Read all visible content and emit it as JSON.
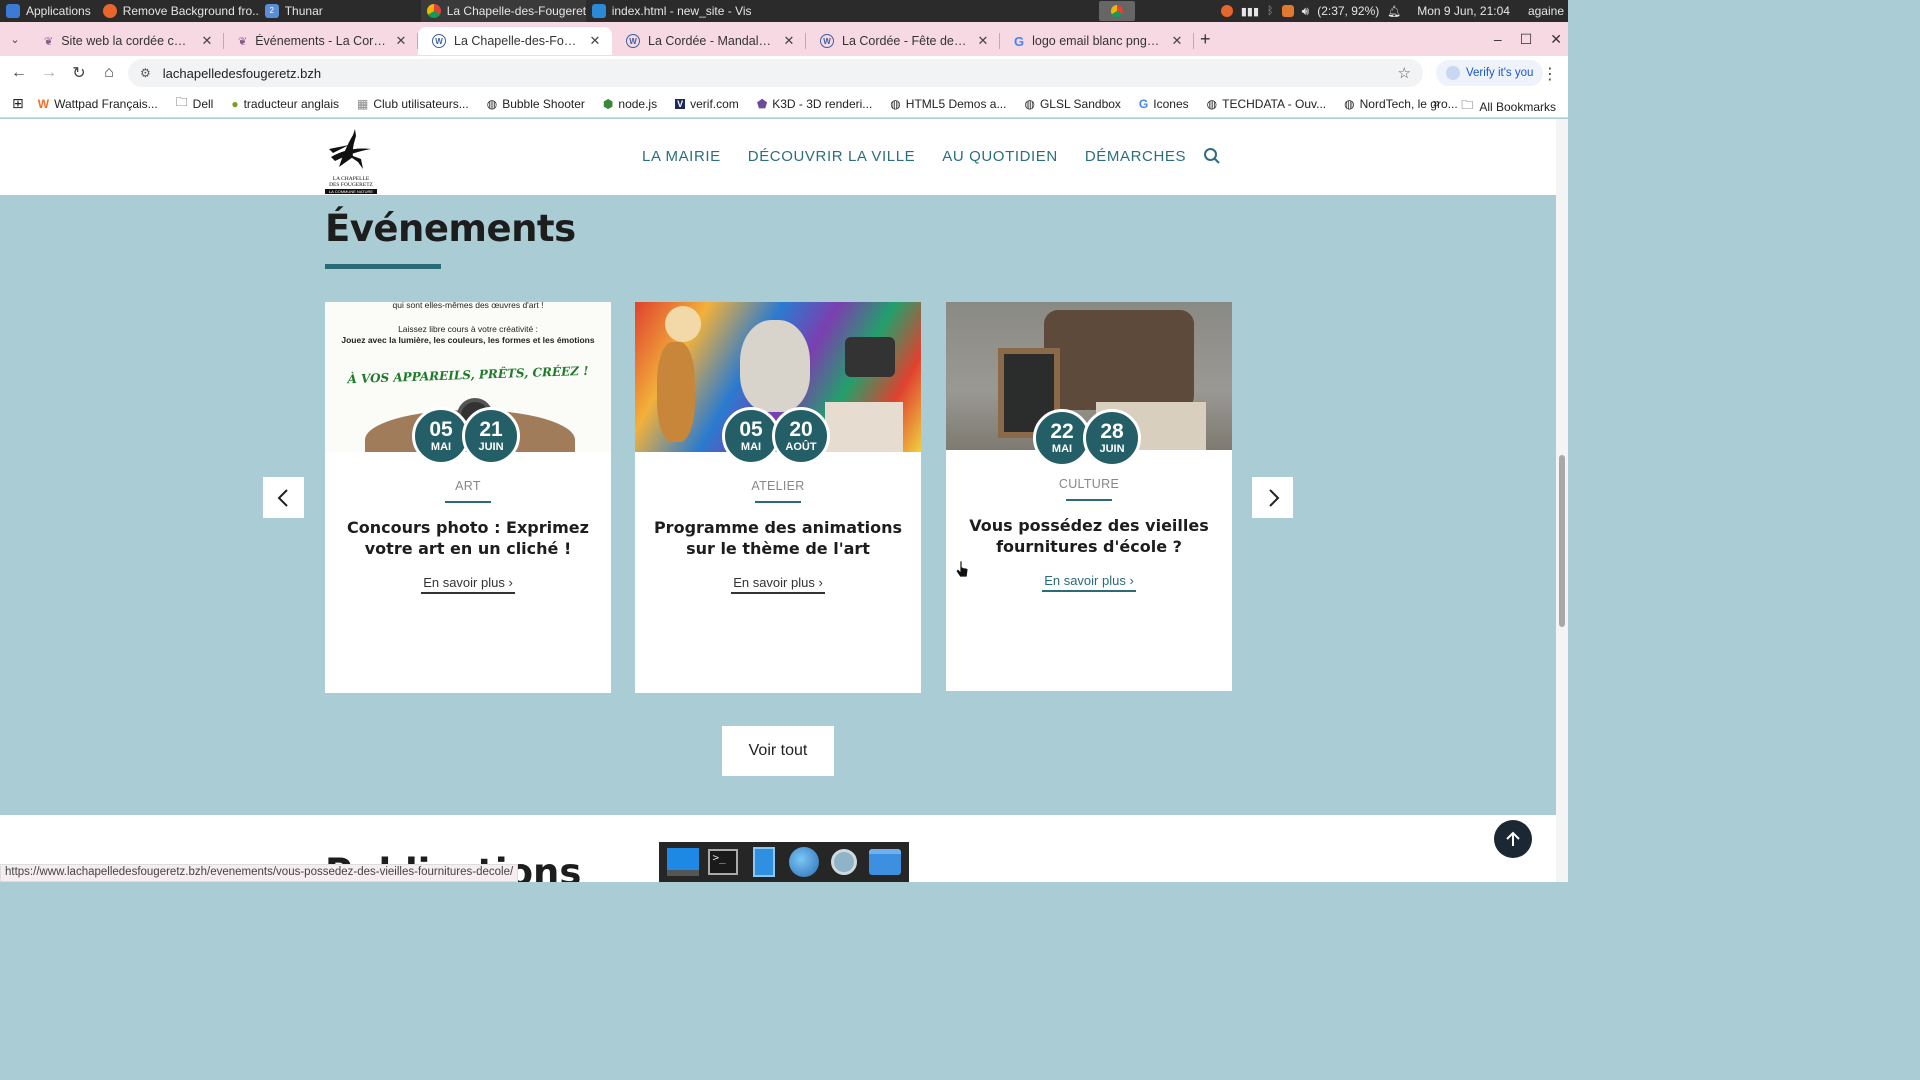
{
  "system_panel": {
    "applications_label": "Applications",
    "tasks": [
      {
        "label": "Remove Background fro..."
      },
      {
        "label": "Thunar",
        "badge": "2"
      },
      {
        "label": "La Chapelle-des-Fougeret..."
      },
      {
        "label": "index.html - new_site - Vis..."
      }
    ],
    "battery": "(2:37, 92%)",
    "clock": "Mon 9 Jun, 21:04",
    "user": "againe"
  },
  "browser": {
    "tabs": [
      {
        "title": "Site web la cordée coté clie",
        "icon": "leaf-icon",
        "active": false
      },
      {
        "title": "Événements - La Cordée",
        "icon": "leaf-icon",
        "active": false
      },
      {
        "title": "La Chapelle-des-Fougeretz",
        "icon": "wordpress-icon",
        "active": true
      },
      {
        "title": "La Cordée - Mandala sonore",
        "icon": "wordpress-icon",
        "active": false
      },
      {
        "title": "La Cordée - Fête des confitu",
        "icon": "wordpress-icon",
        "active": false
      },
      {
        "title": "logo email blanc png - Rech",
        "icon": "google-icon",
        "active": false
      }
    ],
    "new_tab_label": "+",
    "url": "lachapelledesfougeretz.bzh",
    "verify_label": "Verify it's you",
    "bookmarks": [
      {
        "label": "Wattpad Français...",
        "icon": "wattpad-icon"
      },
      {
        "label": "Dell",
        "icon": "folder-icon"
      },
      {
        "label": "traducteur anglais",
        "icon": "bulb-icon"
      },
      {
        "label": "Club utilisateurs...",
        "icon": "grid-icon"
      },
      {
        "label": "Bubble Shooter",
        "icon": "globe-icon"
      },
      {
        "label": "node.js",
        "icon": "node-icon"
      },
      {
        "label": "verif.com",
        "icon": "v-icon"
      },
      {
        "label": "K3D - 3D renderi...",
        "icon": "k3d-icon"
      },
      {
        "label": "HTML5 Demos a...",
        "icon": "globe-icon"
      },
      {
        "label": "GLSL Sandbox",
        "icon": "globe-icon"
      },
      {
        "label": "Icones",
        "icon": "google-icon"
      },
      {
        "label": "TECHDATA - Ouv...",
        "icon": "globe-icon"
      },
      {
        "label": "NordTech, le gro...",
        "icon": "globe-icon"
      }
    ],
    "all_bookmarks_label": "All Bookmarks",
    "more_label": "»",
    "status_url": "https://www.lachapelledesfougeretz.bzh/evenements/vous-possedez-des-vieilles-fournitures-decole/"
  },
  "site": {
    "logo": {
      "line1": "LA CHAPELLE",
      "line2": "DES FOUGERETZ",
      "tagline": "LA COMMUNE NATURE"
    },
    "nav": [
      "LA MAIRIE",
      "DÉCOUVRIR LA VILLE",
      "AU QUOTIDIEN",
      "DÉMARCHES"
    ],
    "events": {
      "title": "Événements",
      "cards": [
        {
          "start_day": "05",
          "start_month": "MAI",
          "end_day": "21",
          "end_month": "JUIN",
          "category": "ART",
          "title": "Concours photo : Exprimez votre art en un cliché !",
          "link": "En savoir plus",
          "image_text": {
            "line1": "qui sont elles-mêmes des œuvres d'art !",
            "line2": "Laissez libre cours à votre créativité :",
            "line3": "Jouez avec la lumière, les couleurs, les formes et les émotions",
            "slogan": "À VOS APPAREILS, PRÊTS, CRÉEZ !"
          }
        },
        {
          "start_day": "05",
          "start_month": "MAI",
          "end_day": "20",
          "end_month": "AOÛT",
          "category": "ATELIER",
          "title": "Programme des animations sur le thème de l'art",
          "link": "En savoir plus"
        },
        {
          "start_day": "22",
          "start_month": "MAI",
          "end_day": "28",
          "end_month": "JUIN",
          "category": "CULTURE",
          "title": "Vous possédez des vieilles fournitures d'école ?",
          "link": "En savoir plus"
        }
      ],
      "voir_tout": "Voir tout"
    },
    "publications_title": "Publications"
  },
  "colors": {
    "page_bg": "#a9ccd5",
    "accent": "#2a6b77",
    "date_badge": "#245f68",
    "tabstrip": "#f7d9e3"
  }
}
